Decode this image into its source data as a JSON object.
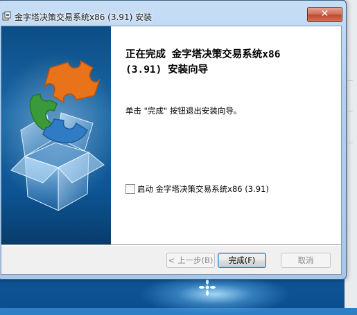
{
  "window": {
    "title": "金字塔决策交易系统x86 (3.91) 安装"
  },
  "main": {
    "heading_line1": "正在完成 金字塔决策交易系统x86",
    "heading_line2": "(3.91) 安装向导",
    "description": "单击 \"完成\" 按钮退出安装向导。",
    "launch_checkbox_label": "启动 金字塔决策交易系统x86 (3.91)",
    "launch_checked": false
  },
  "buttons": {
    "back": "< 上一步(B)",
    "finish": "完成(F)",
    "cancel": "取消"
  },
  "titlebar": {
    "close_label": "✕"
  },
  "colors": {
    "accent": "#1e6fb5",
    "puzzle_orange": "#e8731a",
    "puzzle_green": "#3a9a3a",
    "puzzle_blue": "#2f7cc4"
  },
  "icons": [
    "installer-icon",
    "close-icon",
    "puzzle-box-icon",
    "checkbox-icon",
    "desktop-sparkle-icon"
  ]
}
